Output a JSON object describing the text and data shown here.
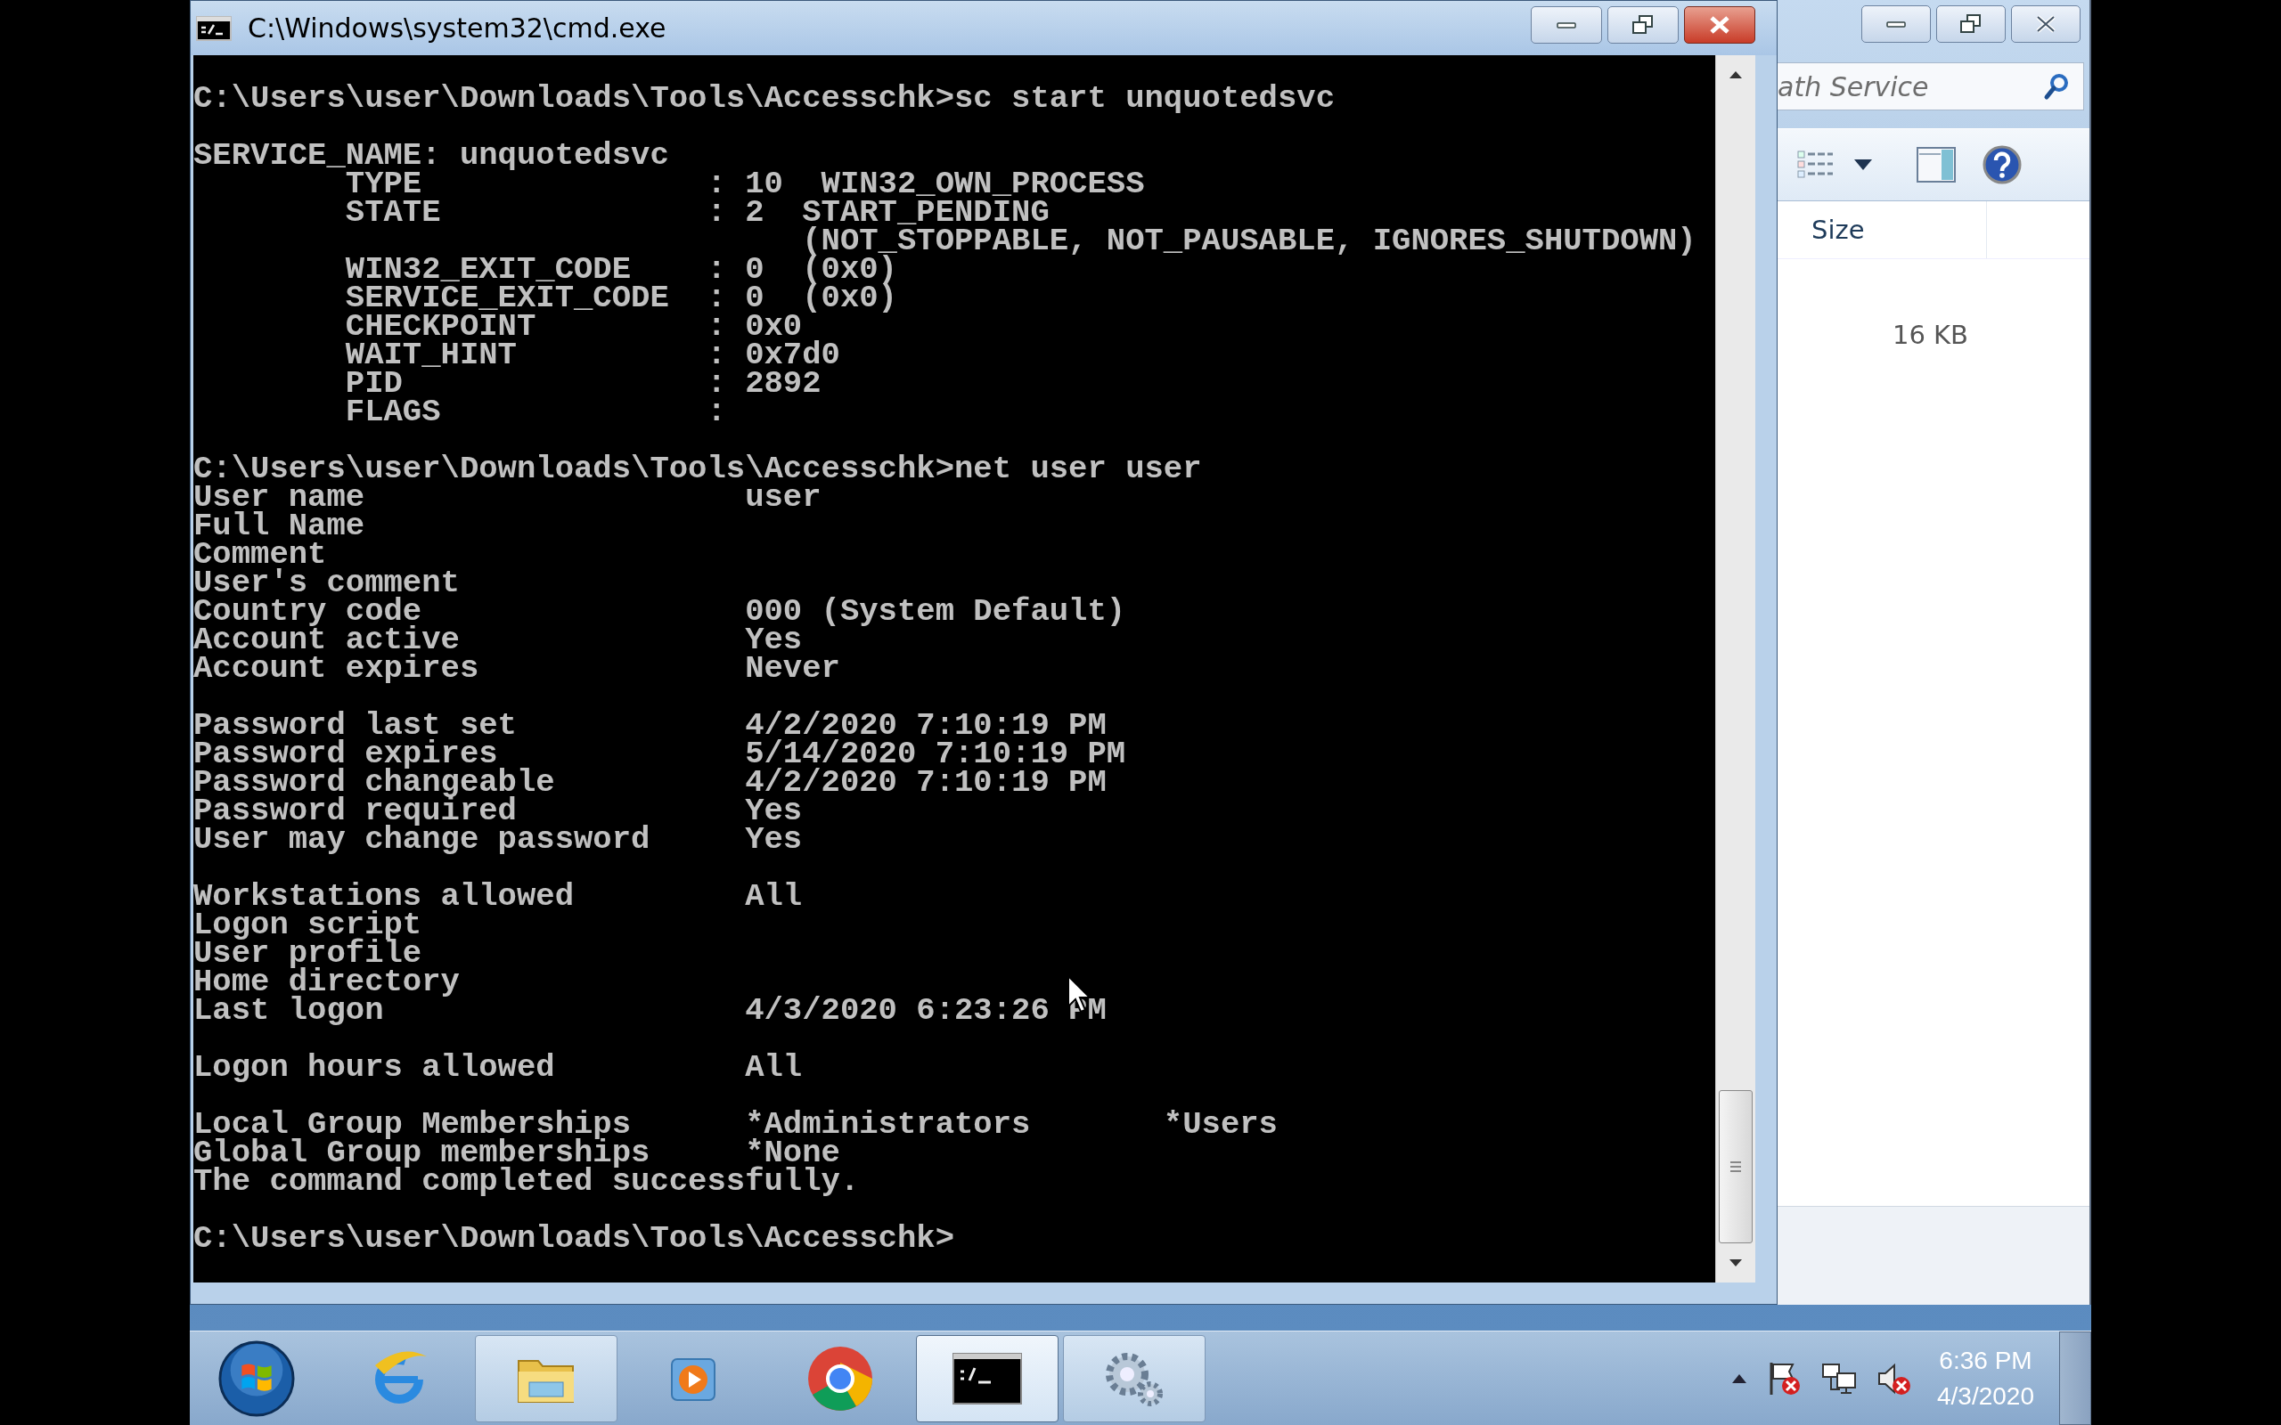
{
  "cmd_window": {
    "title": "C:\\Windows\\system32\\cmd.exe",
    "console": {
      "blocks": [
        [
          "C:\\Users\\user\\Downloads\\Tools\\Accesschk>sc start unquotedsvc"
        ],
        [
          "SERVICE_NAME: unquotedsvc",
          "        TYPE               : 10  WIN32_OWN_PROCESS",
          "        STATE              : 2  START_PENDING",
          "                                (NOT_STOPPABLE, NOT_PAUSABLE, IGNORES_SHUTDOWN)",
          "        WIN32_EXIT_CODE    : 0  (0x0)",
          "        SERVICE_EXIT_CODE  : 0  (0x0)",
          "        CHECKPOINT         : 0x0",
          "        WAIT_HINT          : 0x7d0",
          "        PID                : 2892",
          "        FLAGS              :"
        ],
        [
          "C:\\Users\\user\\Downloads\\Tools\\Accesschk>net user user",
          "User name                    user",
          "Full Name",
          "Comment",
          "User's comment",
          "Country code                 000 (System Default)",
          "Account active               Yes",
          "Account expires              Never"
        ],
        [
          "Password last set            4/2/2020 7:10:19 PM",
          "Password expires             5/14/2020 7:10:19 PM",
          "Password changeable          4/2/2020 7:10:19 PM",
          "Password required            Yes",
          "User may change password     Yes"
        ],
        [
          "Workstations allowed         All",
          "Logon script",
          "User profile",
          "Home directory",
          "Last logon                   4/3/2020 6:23:26 PM"
        ],
        [
          "Logon hours allowed          All"
        ],
        [
          "Local Group Memberships      *Administrators       *Users",
          "Global Group memberships     *None",
          "The command completed successfully."
        ]
      ],
      "prompt": "C:\\Users\\user\\Downloads\\Tools\\Accesschk>"
    }
  },
  "explorer_window": {
    "search": {
      "placeholder": "ath Service"
    },
    "columns": [
      "Size"
    ],
    "rows": [
      [
        "16 KB"
      ]
    ]
  },
  "taskbar": {
    "items": [
      {
        "kind": "start"
      },
      {
        "kind": "browser-e",
        "running": false,
        "selected": false
      },
      {
        "kind": "folder",
        "running": true,
        "selected": false
      },
      {
        "kind": "media",
        "running": false,
        "selected": false
      },
      {
        "kind": "chrome",
        "running": false,
        "selected": false
      },
      {
        "kind": "console",
        "running": true,
        "selected": true
      },
      {
        "kind": "gears",
        "running": true,
        "selected": false
      }
    ],
    "tray": {
      "time": "6:36 PM",
      "date": "4/3/2020"
    }
  }
}
